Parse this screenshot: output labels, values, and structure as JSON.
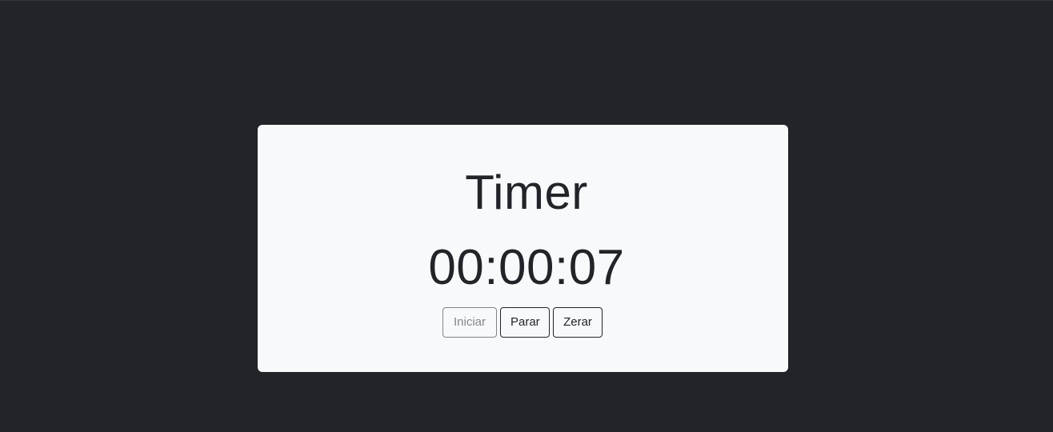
{
  "timer": {
    "title": "Timer",
    "time": "00:00:07"
  },
  "controls": {
    "start_label": "Iniciar",
    "stop_label": "Parar",
    "reset_label": "Zerar"
  }
}
